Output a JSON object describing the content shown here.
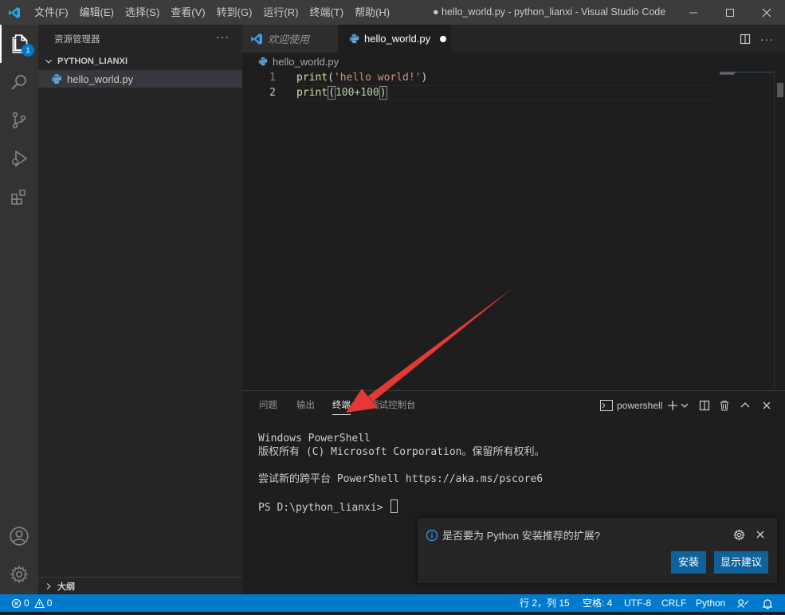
{
  "titlebar": {
    "menus": [
      "文件(F)",
      "编辑(E)",
      "选择(S)",
      "查看(V)",
      "转到(G)",
      "运行(R)",
      "终端(T)",
      "帮助(H)"
    ],
    "window_title": "● hello_world.py - python_lianxi - Visual Studio Code"
  },
  "activity": {
    "explorer_badge": "1"
  },
  "sidebar": {
    "title": "资源管理器",
    "more": "···",
    "folder": "PYTHON_LIANXI",
    "file": "hello_world.py",
    "outline": "大纲"
  },
  "tabs": {
    "welcome": "欢迎使用",
    "active": "hello_world.py"
  },
  "breadcrumb": {
    "file": "hello_world.py"
  },
  "editor": {
    "lines": [
      {
        "num": "1",
        "fn": "print",
        "open": "(",
        "arg": "'hello world!'",
        "close": ")"
      },
      {
        "num": "2",
        "fn": "print",
        "open": "(",
        "arg": "100+100",
        "close": ")"
      }
    ]
  },
  "panel": {
    "tabs": [
      "问题",
      "输出",
      "终端",
      "调试控制台"
    ],
    "active_tab": "终端",
    "shell": "powershell",
    "terminal_lines": [
      "Windows PowerShell",
      "版权所有 (C) Microsoft Corporation。保留所有权利。",
      "",
      "尝试新的跨平台 PowerShell https://aka.ms/pscore6",
      "",
      "PS D:\\python_lianxi> "
    ]
  },
  "notification": {
    "message": "是否要为 Python 安装推荐的扩展?",
    "install": "安装",
    "show": "显示建议"
  },
  "status": {
    "errors": "0",
    "warnings": "0",
    "position": "行 2，列 15",
    "spaces": "空格: 4",
    "encoding": "UTF-8",
    "eol": "CRLF",
    "language": "Python"
  },
  "colors": {
    "accent": "#007acc",
    "arrow": "#e53935"
  }
}
